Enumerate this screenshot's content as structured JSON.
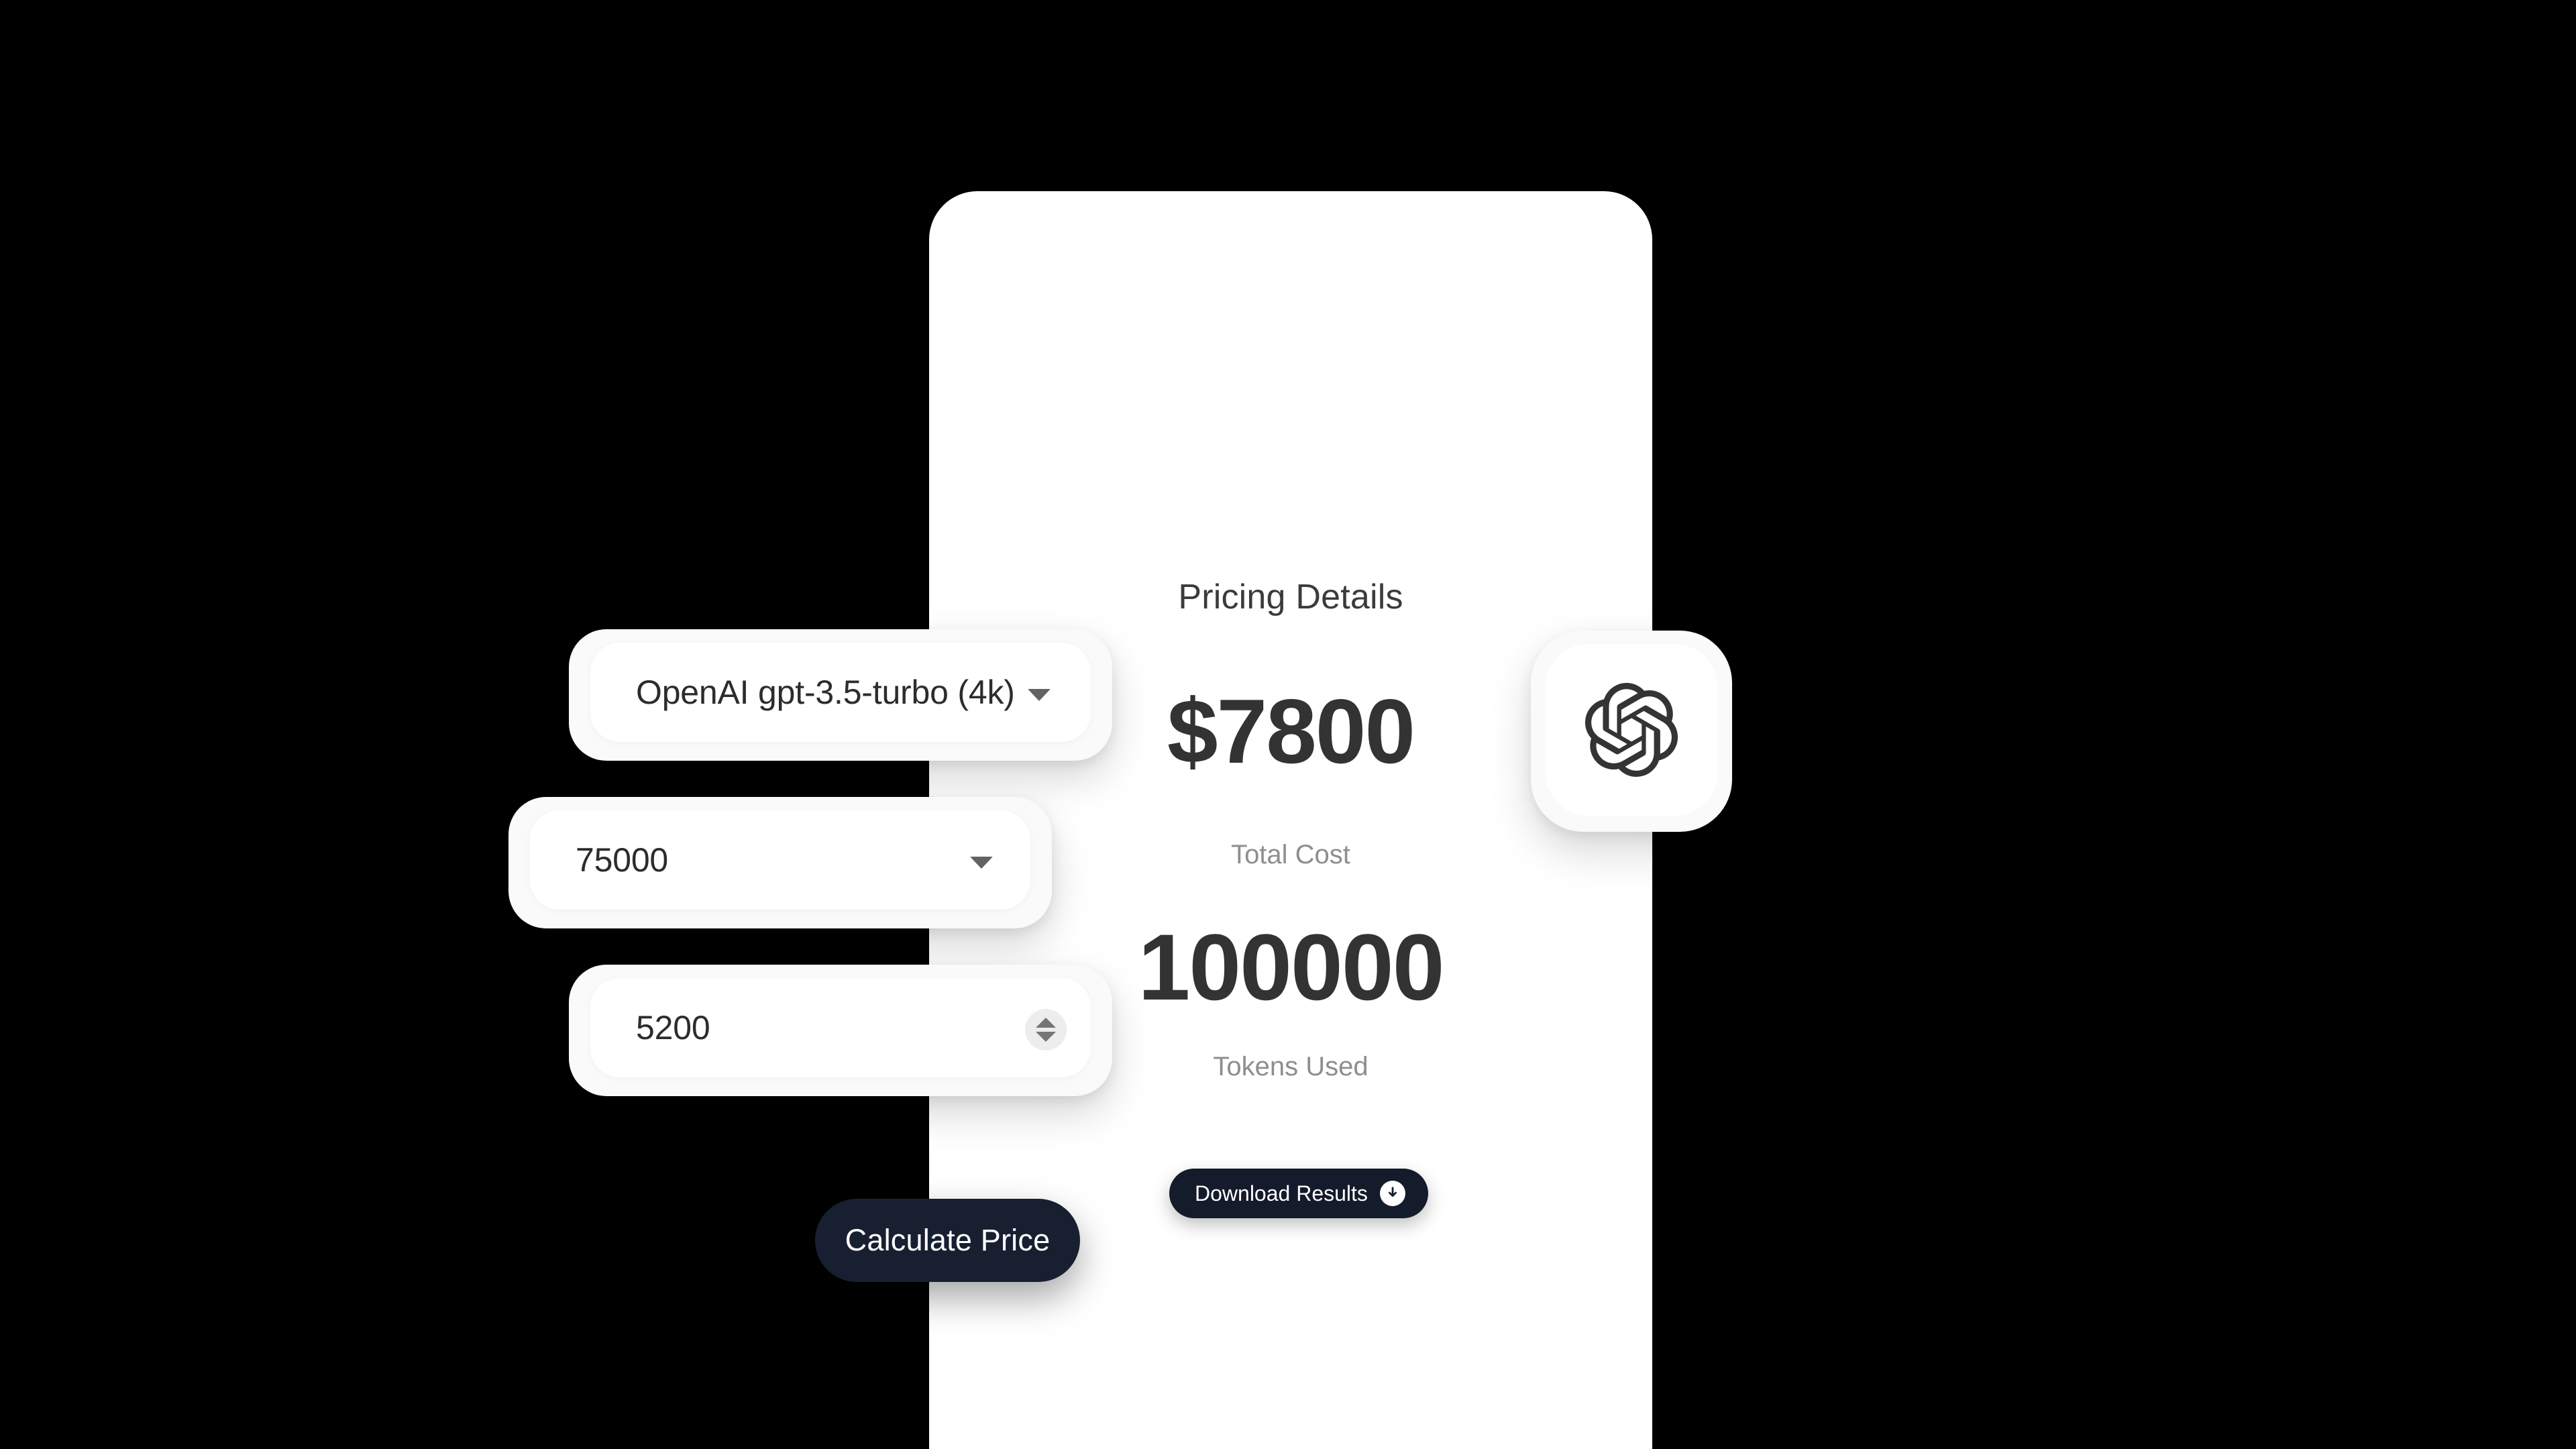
{
  "panel": {
    "background": "#ffffff"
  },
  "form": {
    "model_select": {
      "value": "OpenAI gpt-3.5-turbo (4k)",
      "caret_icon": "chevron-down-icon"
    },
    "tokens_select": {
      "value": "75000",
      "caret_icon": "chevron-down-icon"
    },
    "rate_input": {
      "value": "5200",
      "stepper_icon": "up-down-stepper-icon"
    }
  },
  "brand": {
    "logo_icon": "openai-logo-icon",
    "logo_color": "#343434"
  },
  "pricing": {
    "title": "Pricing Details",
    "total_cost_value": "$7800",
    "total_cost_label": "Total Cost",
    "tokens_value": "100000",
    "tokens_label": "Tokens Used"
  },
  "actions": {
    "download_label": "Download Results",
    "download_icon": "download-arrow-icon",
    "calculate_label": "Calculate Price",
    "button_color": "#141b2b"
  }
}
